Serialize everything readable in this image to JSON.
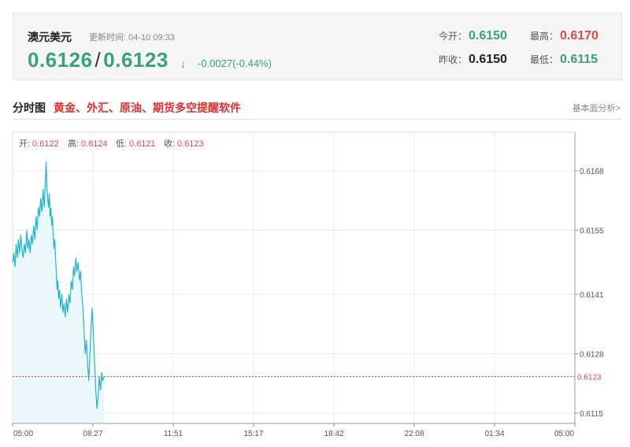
{
  "quote": {
    "name": "澳元美元",
    "time_label": "更新时间: 04-10 09:33",
    "bid": "0.6126",
    "separator": "/",
    "ask": "0.6123",
    "arrow": "↓",
    "change": "-0.0027(-0.44%)",
    "open_label": "今开：",
    "open_value": "0.6150",
    "high_label": "最高：",
    "high_value": "0.6170",
    "prev_label": "昨收：",
    "prev_value": "0.6150",
    "low_label": "最低：",
    "low_value": "0.6115"
  },
  "section": {
    "title": "分时图",
    "promo_link": "黄金、外汇、原油、期货多空提醒软件",
    "right_link": "基本面分析>"
  },
  "colors": {
    "up": "#e24a47",
    "down": "#3aa17e",
    "line": "#1fb6cc",
    "area": "#eaf8fb",
    "last_line": "#e24a47"
  },
  "chart_data": {
    "type": "line",
    "ohlc": {
      "open_label": "开:",
      "open": "0.6122",
      "high_label": "高:",
      "high": "0.6124",
      "low_label": "低:",
      "low": "0.6121",
      "close_label": "收:",
      "close": "0.6123"
    },
    "x_ticks": [
      "05:00",
      "08:27",
      "11:51",
      "15:17",
      "18:42",
      "22:08",
      "01:34",
      "05:00"
    ],
    "y_ticks": [
      "0.6168",
      "0.6155",
      "0.6141",
      "0.6128",
      "0.6115"
    ],
    "ylim": [
      0.6115,
      0.6168
    ],
    "last_price_label": "0.6123",
    "last_price": 0.6123,
    "x_unit": "minutes since 05:00",
    "x_range": [
      0,
      1440
    ],
    "series": [
      {
        "values": [
          [
            0,
            0.6148
          ],
          [
            3,
            0.615
          ],
          [
            6,
            0.6147
          ],
          [
            9,
            0.6152
          ],
          [
            12,
            0.6149
          ],
          [
            15,
            0.6153
          ],
          [
            18,
            0.615
          ],
          [
            21,
            0.6154
          ],
          [
            24,
            0.6151
          ],
          [
            27,
            0.6149
          ],
          [
            30,
            0.6152
          ],
          [
            33,
            0.615
          ],
          [
            36,
            0.6155
          ],
          [
            39,
            0.6151
          ],
          [
            42,
            0.6153
          ],
          [
            45,
            0.615
          ],
          [
            48,
            0.6154
          ],
          [
            51,
            0.6152
          ],
          [
            54,
            0.6156
          ],
          [
            57,
            0.6153
          ],
          [
            60,
            0.6158
          ],
          [
            63,
            0.6155
          ],
          [
            66,
            0.616
          ],
          [
            69,
            0.6158
          ],
          [
            72,
            0.6162
          ],
          [
            75,
            0.6159
          ],
          [
            78,
            0.6164
          ],
          [
            81,
            0.616
          ],
          [
            84,
            0.6166
          ],
          [
            86,
            0.617
          ],
          [
            88,
            0.6164
          ],
          [
            90,
            0.6162
          ],
          [
            92,
            0.616
          ],
          [
            94,
            0.6163
          ],
          [
            96,
            0.6158
          ],
          [
            98,
            0.616
          ],
          [
            100,
            0.6156
          ],
          [
            102,
            0.6158
          ],
          [
            104,
            0.6154
          ],
          [
            106,
            0.6151
          ],
          [
            108,
            0.6153
          ],
          [
            110,
            0.6149
          ],
          [
            112,
            0.6146
          ],
          [
            114,
            0.6142
          ],
          [
            116,
            0.6144
          ],
          [
            118,
            0.614
          ],
          [
            120,
            0.6142
          ],
          [
            123,
            0.6138
          ],
          [
            126,
            0.6141
          ],
          [
            129,
            0.6137
          ],
          [
            132,
            0.6139
          ],
          [
            135,
            0.6136
          ],
          [
            138,
            0.614
          ],
          [
            141,
            0.6137
          ],
          [
            144,
            0.6141
          ],
          [
            147,
            0.6139
          ],
          [
            150,
            0.6144
          ],
          [
            153,
            0.6142
          ],
          [
            156,
            0.6147
          ],
          [
            159,
            0.6145
          ],
          [
            162,
            0.6149
          ],
          [
            165,
            0.6146
          ],
          [
            168,
            0.6148
          ],
          [
            171,
            0.6144
          ],
          [
            174,
            0.6146
          ],
          [
            177,
            0.6141
          ],
          [
            180,
            0.6138
          ],
          [
            183,
            0.6133
          ],
          [
            186,
            0.6128
          ],
          [
            189,
            0.6131
          ],
          [
            192,
            0.6126
          ],
          [
            195,
            0.6122
          ],
          [
            198,
            0.6128
          ],
          [
            201,
            0.6134
          ],
          [
            204,
            0.6138
          ],
          [
            207,
            0.6132
          ],
          [
            210,
            0.6126
          ],
          [
            213,
            0.612
          ],
          [
            216,
            0.6116
          ],
          [
            219,
            0.6119
          ],
          [
            222,
            0.6123
          ],
          [
            225,
            0.612
          ],
          [
            228,
            0.6124
          ],
          [
            231,
            0.6122
          ],
          [
            234,
            0.6123
          ]
        ]
      }
    ]
  }
}
